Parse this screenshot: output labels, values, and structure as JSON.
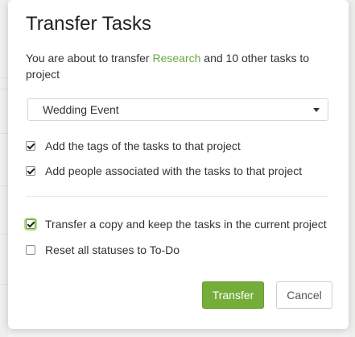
{
  "dialog": {
    "title": "Transfer Tasks",
    "intro": {
      "prefix": "You are about to transfer ",
      "task_link": "Research",
      "suffix": " and 10 other tasks to project"
    },
    "project_select": {
      "value": "Wedding Event"
    },
    "options": [
      {
        "label": "Add the tags of the tasks to that project",
        "checked": true
      },
      {
        "label": "Add people associated with the tasks to that project",
        "checked": true
      },
      {
        "label": "Transfer a copy and keep the tasks in the current project",
        "checked": true
      },
      {
        "label": "Reset all statuses to To-Do",
        "checked": false
      }
    ],
    "buttons": {
      "transfer": "Transfer",
      "cancel": "Cancel"
    }
  },
  "colors": {
    "accent": "#75ad3b",
    "link": "#6aa842"
  }
}
